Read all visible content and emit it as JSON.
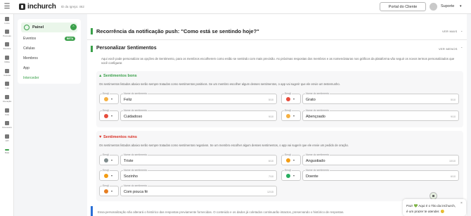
{
  "topbar": {
    "logo_text": "inchurch",
    "church_id": "ID da Igreja: 462",
    "portal_button": "Portal do Cliente",
    "support_label": "Suporte"
  },
  "leftnav": {
    "items": [
      {
        "label": "Início",
        "icon": "home-icon"
      },
      {
        "label": "Pessoas",
        "icon": "people-icon"
      },
      {
        "label": "Eventos",
        "icon": "calendar-icon"
      },
      {
        "label": "Mídia",
        "icon": "media-icon"
      },
      {
        "label": "Células",
        "icon": "cells-icon"
      },
      {
        "label": "Loja",
        "icon": "store-icon"
      },
      {
        "label": "Interação",
        "icon": "interaction-icon"
      },
      {
        "label": "Kids",
        "icon": "kids-icon"
      },
      {
        "label": "Financeiro",
        "icon": "finance-icon"
      },
      {
        "label": "API",
        "icon": "api-icon"
      },
      {
        "label": "Mais",
        "icon": "more-icon"
      }
    ]
  },
  "submenu": {
    "header": "Painel",
    "items": [
      {
        "label": "Eventos",
        "badge": "BETA"
      },
      {
        "label": "Células"
      },
      {
        "label": "Membros"
      },
      {
        "label": "App"
      },
      {
        "label": "Interceder",
        "active": true
      }
    ]
  },
  "section1": {
    "title": "Recorrência da notificação push: \"Como está se sentindo hoje?\"",
    "see_more": "VER MAIS"
  },
  "section2": {
    "title": "Personalizar Sentimentos",
    "see_less": "VER MENOS",
    "description": "Aqui você pode personalizar as opções de Sentimento, para os membros escolherem como estão se sentindo com mais precisão. As próximas respostas dos membros e as nomenclaturas nos gráficos da plataforma vão seguir os novos termos personalizados que você configurar."
  },
  "good": {
    "title": "Sentimentos bons",
    "description": "Os sentimentos listados abaixo serão sempre tratados como sentimentos positivos. Se um membro escolher algum desses sentimentos, o app vai sugerir que ele envie um testemunho.",
    "emoji_legend": "Emoji",
    "name_legend": "Nome do sentimento",
    "fields": [
      {
        "value": "Feliz",
        "count": "5/10",
        "emoji_color": "#f5b041"
      },
      {
        "value": "Grato",
        "count": "5/10",
        "emoji_color": "#e74c3c"
      },
      {
        "value": "Cuidadoso",
        "count": "9/10",
        "emoji_color": "#e74c3c"
      },
      {
        "value": "Abençoado",
        "count": "9/10",
        "emoji_color": "#f5b041"
      }
    ]
  },
  "bad": {
    "title": "Sentimentos ruins",
    "description": "Os sentimentos listados abaixo serão sempre tratados como sentimentos negativos. Se um membro escolher algum desses sentimentos, o app vai sugerir que ele envie um pedido de oração.",
    "emoji_legend": "Emoji",
    "name_legend": "Nome do sentimento",
    "fields": [
      {
        "value": "Triste",
        "count": "6/10",
        "emoji_color": "#7f8c8d"
      },
      {
        "value": "Angustiado",
        "count": "10/10",
        "emoji_color": "#f39c12"
      },
      {
        "value": "Sozinho",
        "count": "7/10",
        "emoji_color": "#f39c12"
      },
      {
        "value": "Doente",
        "count": "6/10",
        "emoji_color": "#27ae60"
      },
      {
        "value": "Com pouca fé",
        "count": "12/15",
        "emoji_color": "#e67e22"
      }
    ]
  },
  "info": {
    "text": "Essa personalização não alterará o histórico das respostas previamente fornecidas. O conteúdo e os dados já coletados continuarão intactos, preservando o histórico de respostas."
  },
  "chat": {
    "line1": "Paz! 💚 Aqui é o Tito da inChurch,",
    "line2": "é um prazer te atender. 😊"
  },
  "colors": {
    "accent": "#3aa04a",
    "good": "#3aa04a",
    "bad": "#d93025",
    "info": "#2a6fd6"
  }
}
